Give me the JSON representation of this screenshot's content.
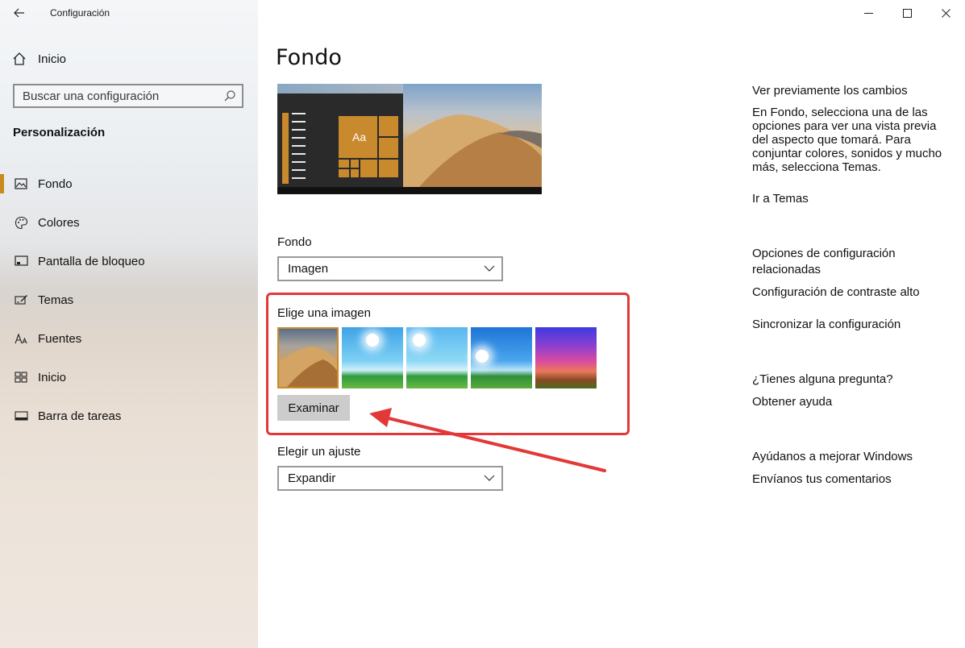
{
  "window": {
    "title": "Configuración"
  },
  "sidebar": {
    "home_label": "Inicio",
    "search_placeholder": "Buscar una configuración",
    "section_title": "Personalización",
    "items": [
      {
        "label": "Fondo",
        "icon": "picture-icon",
        "active": true
      },
      {
        "label": "Colores",
        "icon": "palette-icon",
        "active": false
      },
      {
        "label": "Pantalla de bloqueo",
        "icon": "lock-screen-icon",
        "active": false
      },
      {
        "label": "Temas",
        "icon": "themes-brush-icon",
        "active": false
      },
      {
        "label": "Fuentes",
        "icon": "font-icon",
        "active": false
      },
      {
        "label": "Inicio",
        "icon": "start-grid-icon",
        "active": false
      },
      {
        "label": "Barra de tareas",
        "icon": "taskbar-icon",
        "active": false
      }
    ]
  },
  "main": {
    "title": "Fondo",
    "preview_tile_text": "Aa",
    "background_label": "Fondo",
    "background_value": "Imagen",
    "choose_image_label": "Elige una imagen",
    "thumbnails": [
      "desert",
      "sky-green",
      "sky-green-2",
      "sky-blue",
      "purple-sunset"
    ],
    "browse_button": "Examinar",
    "fit_label": "Elegir un ajuste",
    "fit_value": "Expandir"
  },
  "right": {
    "preview_heading": "Ver previamente los cambios",
    "preview_desc": "En Fondo, selecciona una de las opciones para ver una vista previa del aspecto que tomará. Para conjuntar colores, sonidos y mucho más, selecciona Temas.",
    "themes_link": "Ir a Temas",
    "related_heading": "Opciones de configuración relacionadas",
    "contrast_link": "Configuración de contraste alto",
    "sync_link": "Sincronizar la configuración",
    "question_heading": "¿Tienes alguna pregunta?",
    "help_link": "Obtener ayuda",
    "improve_heading": "Ayúdanos a mejorar Windows",
    "feedback_link": "Envíanos tus comentarios"
  },
  "colors": {
    "accent": "#c98a2e",
    "link": "#b07617",
    "annotation": "#e23838"
  }
}
